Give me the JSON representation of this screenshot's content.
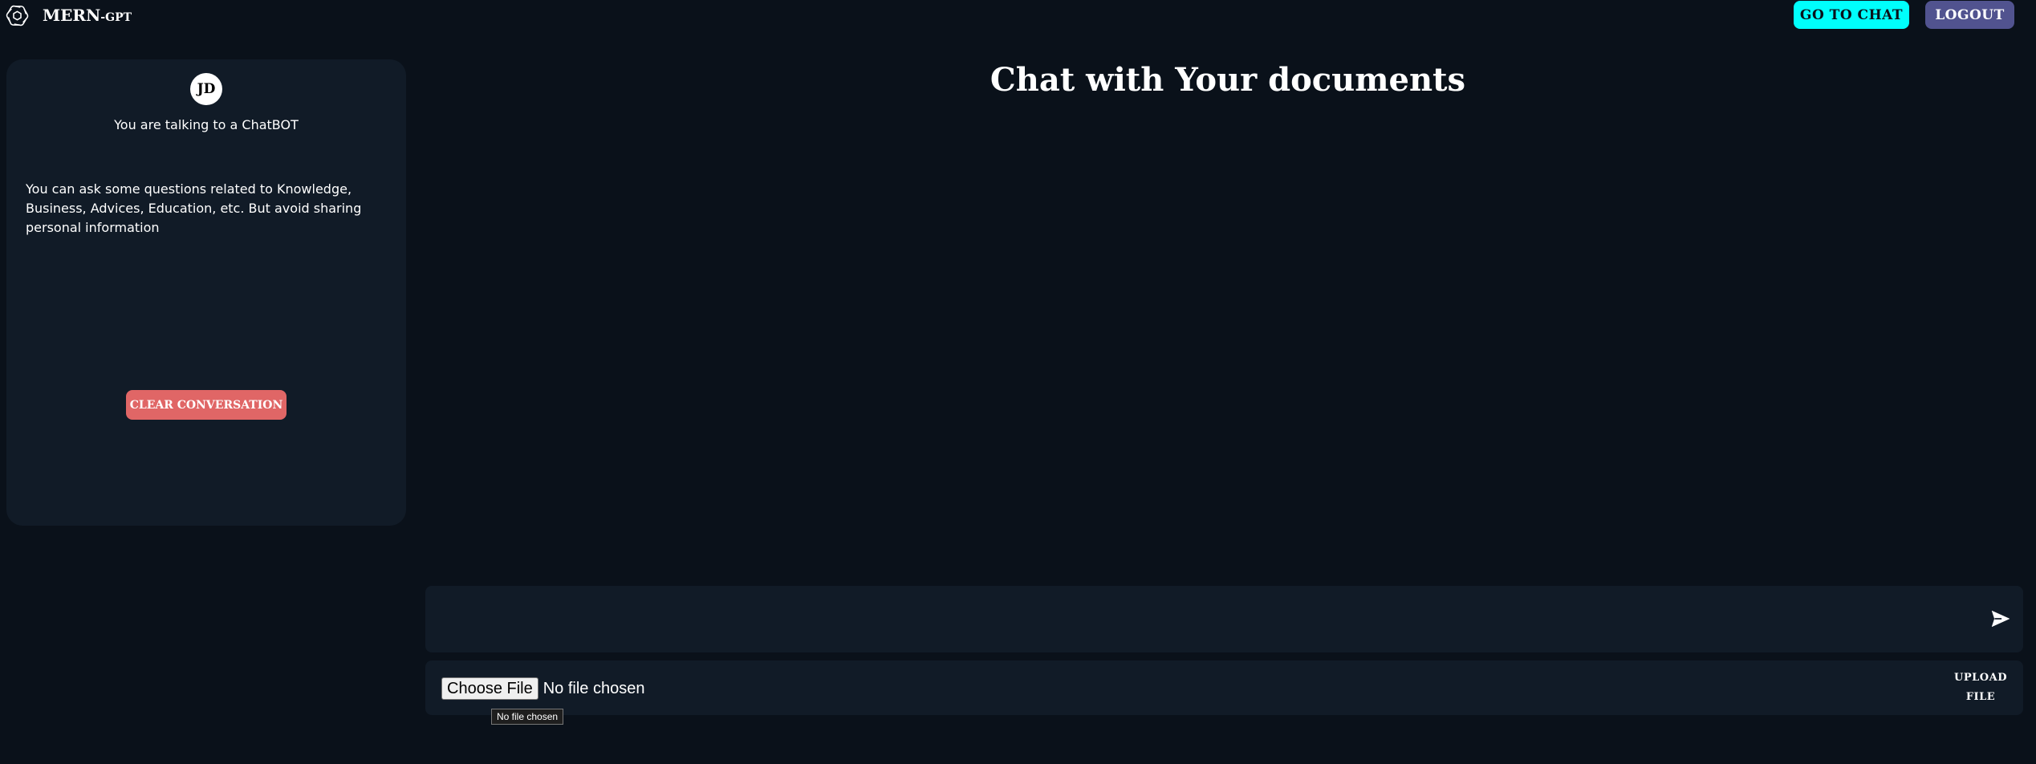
{
  "header": {
    "brand": "MERN",
    "brand_suffix": "-GPT",
    "logo_icon": "openai-logo-icon",
    "go_to_chat_label": "GO TO CHAT",
    "logout_label": "LOGOUT",
    "colors": {
      "go_to_chat_bg": "#00fffc",
      "logout_bg": "#51538f"
    }
  },
  "sidebar": {
    "avatar_initials": "JD",
    "talking_text": "You are talking to a ChatBOT",
    "info_text": "You can ask some questions related to Knowledge, Business, Advices, Education, etc. But avoid sharing personal information",
    "clear_button_label": "CLEAR CONVERSATION",
    "colors": {
      "clear_bg": "#e06666",
      "card_bg": "#111b27"
    }
  },
  "main": {
    "title": "Chat with Your documents",
    "chat_input_value": "",
    "send_icon": "send-icon"
  },
  "upload": {
    "choose_file_label": "Choose File",
    "no_file_text": "No file chosen",
    "upload_button_line1": "UPLOAD",
    "upload_button_line2": "FILE",
    "tooltip_text": "No file chosen"
  },
  "colors": {
    "page_bg": "#0a111a",
    "panel_bg": "#111b27"
  }
}
